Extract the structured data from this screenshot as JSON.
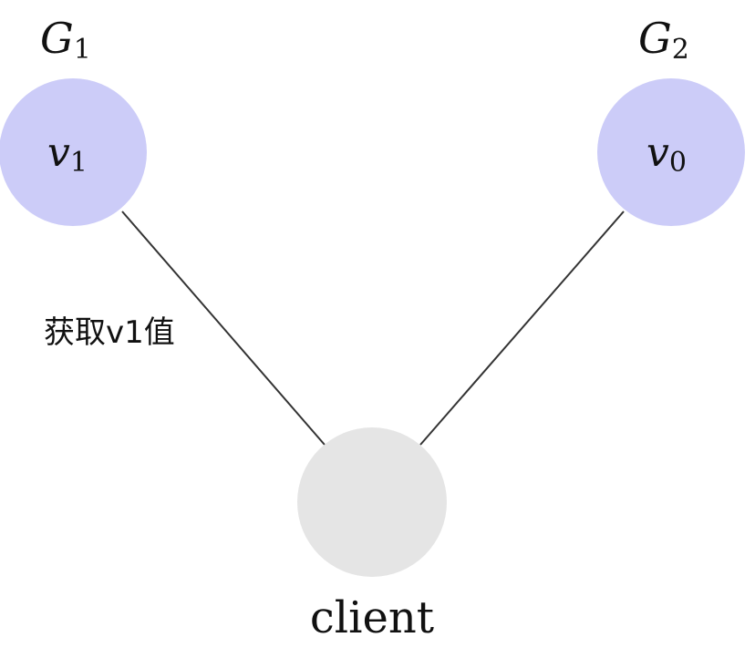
{
  "nodes": {
    "g1": {
      "group_label": "G",
      "group_subscript": "1",
      "value_label": "v",
      "value_subscript": "1",
      "fill": "#ccccf8"
    },
    "g2": {
      "group_label": "G",
      "group_subscript": "2",
      "value_label": "v",
      "value_subscript": "0",
      "fill": "#ccccf8"
    },
    "client": {
      "label": "client",
      "fill": "#e5e5e5"
    }
  },
  "edges": {
    "client_g1_label": "获取v1值",
    "stroke": "#333333"
  }
}
